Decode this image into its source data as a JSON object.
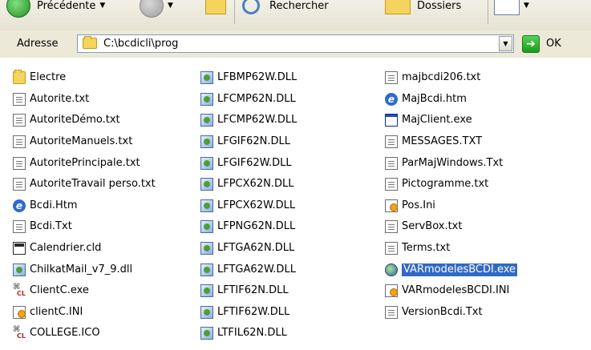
{
  "toolbar": {
    "back_label": "Précédente",
    "search_label": "Rechercher",
    "folders_label": "Dossiers"
  },
  "address": {
    "label": "Adresse",
    "path": "C:\\bcdicli\\prog",
    "go_label": "OK"
  },
  "files": {
    "col1": [
      {
        "name": "Electre",
        "icon": "folder-icon"
      },
      {
        "name": "Autorite.txt",
        "icon": "text-file-icon"
      },
      {
        "name": "AutoriteDémo.txt",
        "icon": "text-file-icon"
      },
      {
        "name": "AutoriteManuels.txt",
        "icon": "text-file-icon"
      },
      {
        "name": "AutoritePrincipale.txt",
        "icon": "text-file-icon"
      },
      {
        "name": "AutoriteTravail perso.txt",
        "icon": "text-file-icon"
      },
      {
        "name": "Bcdi.Htm",
        "icon": "ie-html-icon"
      },
      {
        "name": "Bcdi.Txt",
        "icon": "text-file-icon"
      },
      {
        "name": "Calendrier.cld",
        "icon": "calendar-file-icon"
      },
      {
        "name": "ChilkatMail_v7_9.dll",
        "icon": "dll-file-icon"
      },
      {
        "name": "ClientC.exe",
        "icon": "client-exe-icon"
      },
      {
        "name": "clientC.INI",
        "icon": "ini-file-icon"
      },
      {
        "name": "COLLEGE.ICO",
        "icon": "ico-file-icon"
      }
    ],
    "col2": [
      {
        "name": "LFBMP62W.DLL",
        "icon": "dll-file-icon"
      },
      {
        "name": "LFCMP62N.DLL",
        "icon": "dll-file-icon"
      },
      {
        "name": "LFCMP62W.DLL",
        "icon": "dll-file-icon"
      },
      {
        "name": "LFGIF62N.DLL",
        "icon": "dll-file-icon"
      },
      {
        "name": "LFGIF62W.DLL",
        "icon": "dll-file-icon"
      },
      {
        "name": "LFPCX62N.DLL",
        "icon": "dll-file-icon"
      },
      {
        "name": "LFPCX62W.DLL",
        "icon": "dll-file-icon"
      },
      {
        "name": "LFPNG62N.DLL",
        "icon": "dll-file-icon"
      },
      {
        "name": "LFTGA62N.DLL",
        "icon": "dll-file-icon"
      },
      {
        "name": "LFTGA62W.DLL",
        "icon": "dll-file-icon"
      },
      {
        "name": "LFTIF62N.DLL",
        "icon": "dll-file-icon"
      },
      {
        "name": "LFTIF62W.DLL",
        "icon": "dll-file-icon"
      },
      {
        "name": "LTFIL62N.DLL",
        "icon": "dll-file-icon"
      }
    ],
    "col3": [
      {
        "name": "majbcdi206.txt",
        "icon": "text-file-icon"
      },
      {
        "name": "MajBcdi.htm",
        "icon": "ie-html-icon"
      },
      {
        "name": "MajClient.exe",
        "icon": "exe-window-icon"
      },
      {
        "name": "MESSAGES.TXT",
        "icon": "text-file-icon"
      },
      {
        "name": "ParMajWindows.Txt",
        "icon": "text-file-icon"
      },
      {
        "name": "Pictogramme.txt",
        "icon": "text-file-icon"
      },
      {
        "name": "Pos.Ini",
        "icon": "ini-file-icon"
      },
      {
        "name": "ServBox.txt",
        "icon": "text-file-icon"
      },
      {
        "name": "Terms.txt",
        "icon": "text-file-icon"
      },
      {
        "name": "VARmodelesBCDI.exe",
        "icon": "bcdi-app-icon",
        "selected": true
      },
      {
        "name": "VARmodelesBCDI.INI",
        "icon": "ini-file-icon"
      },
      {
        "name": "VersionBcdi.Txt",
        "icon": "text-file-icon"
      }
    ]
  }
}
